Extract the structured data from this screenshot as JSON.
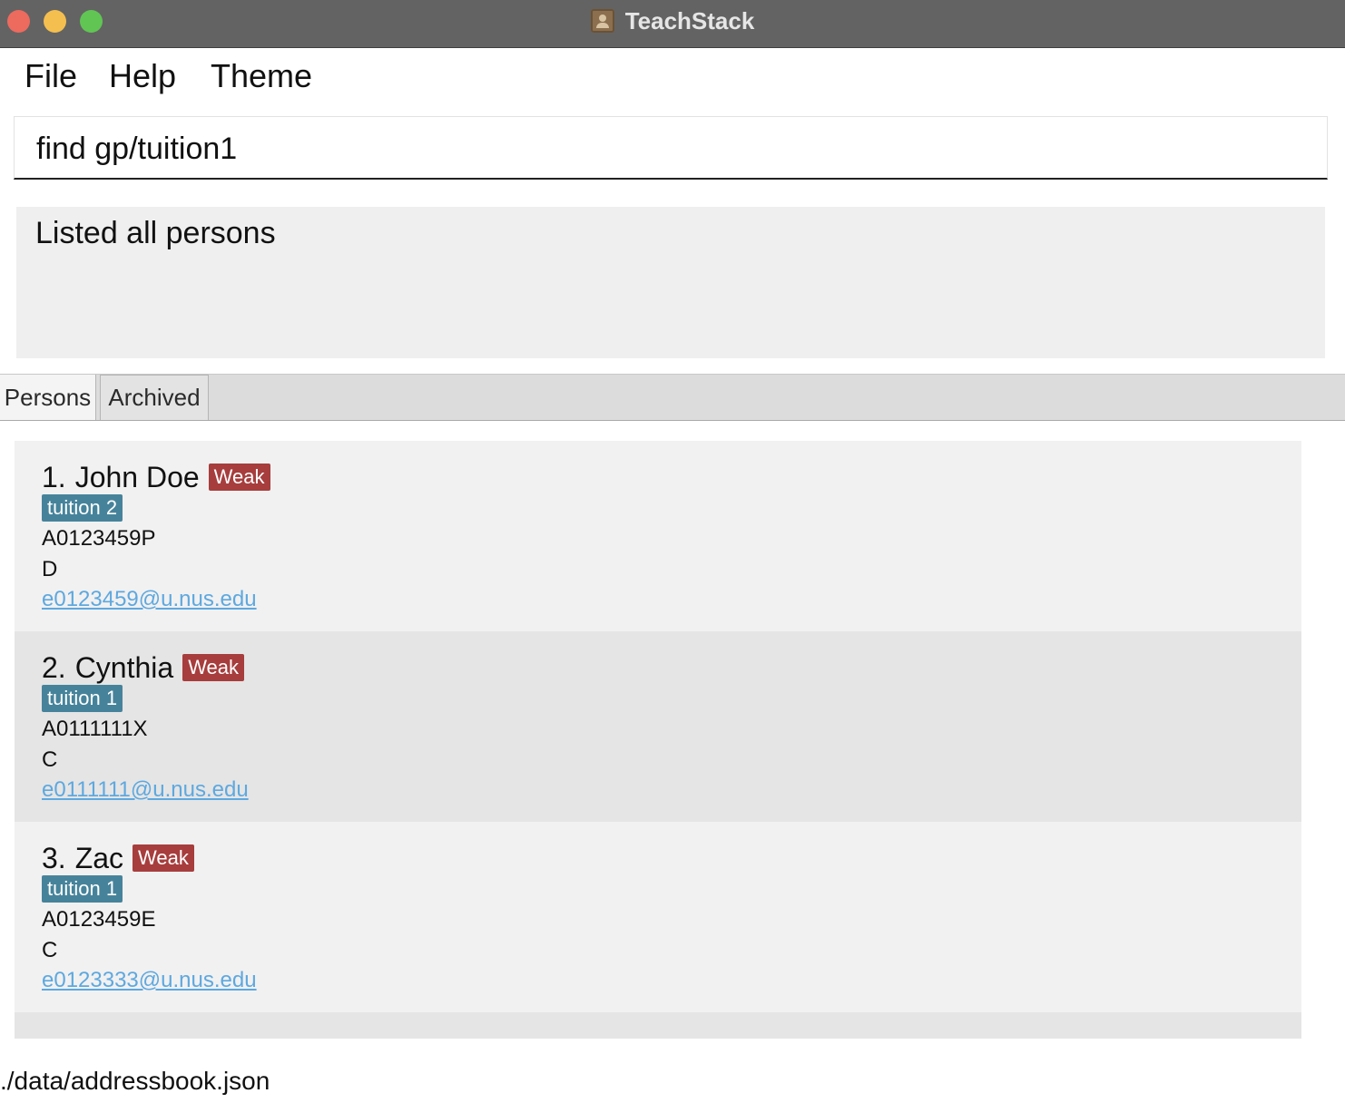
{
  "window": {
    "title": "TeachStack"
  },
  "menu": {
    "file": "File",
    "help": "Help",
    "theme": "Theme"
  },
  "command": {
    "value": "find gp/tuition1"
  },
  "result": {
    "message": "Listed all persons"
  },
  "tabs": {
    "persons": "Persons",
    "archived": "Archived"
  },
  "persons": [
    {
      "index": "1.",
      "name": "John Doe",
      "tag": "Weak",
      "group": "tuition 2",
      "id": "A0123459P",
      "grade": "D",
      "email": "e0123459@u.nus.edu"
    },
    {
      "index": "2.",
      "name": "Cynthia",
      "tag": "Weak",
      "group": "tuition 1",
      "id": "A0111111X",
      "grade": "C",
      "email": "e0111111@u.nus.edu"
    },
    {
      "index": "3.",
      "name": "Zac",
      "tag": "Weak",
      "group": "tuition 1",
      "id": "A0123459E",
      "grade": "C",
      "email": "e0123333@u.nus.edu"
    }
  ],
  "status": {
    "file_path": "./data/addressbook.json"
  },
  "colors": {
    "weak_tag": "#a73d3d",
    "group_tag": "#46839b",
    "email_link": "#5ea8df",
    "titlebar": "#636363"
  }
}
